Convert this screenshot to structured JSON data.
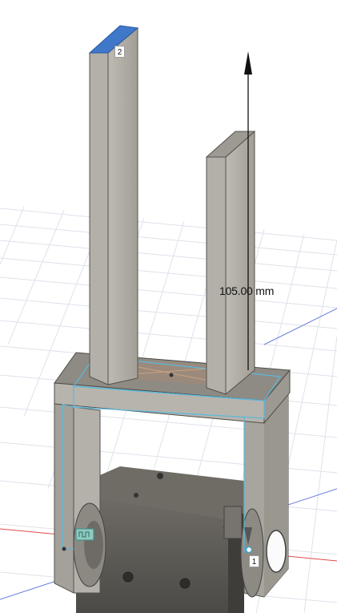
{
  "dimension": {
    "value_text": "105.00 mm"
  },
  "markers": [
    {
      "label": "2"
    },
    {
      "label": "1"
    }
  ],
  "colors": {
    "background": "#ffffff",
    "grid_line": "#d9dee6",
    "body_fill": "#a7a49d",
    "body_dark": "#5e5b55",
    "selected_face": "#3f78c8",
    "sketch_outline": "#59b9de",
    "axis_red": "#e04a4a",
    "axis_blue": "#6b7be0"
  },
  "icons": [
    "extrude-arrow-icon",
    "manipulator-handle-icon",
    "joint-origin-icon"
  ]
}
